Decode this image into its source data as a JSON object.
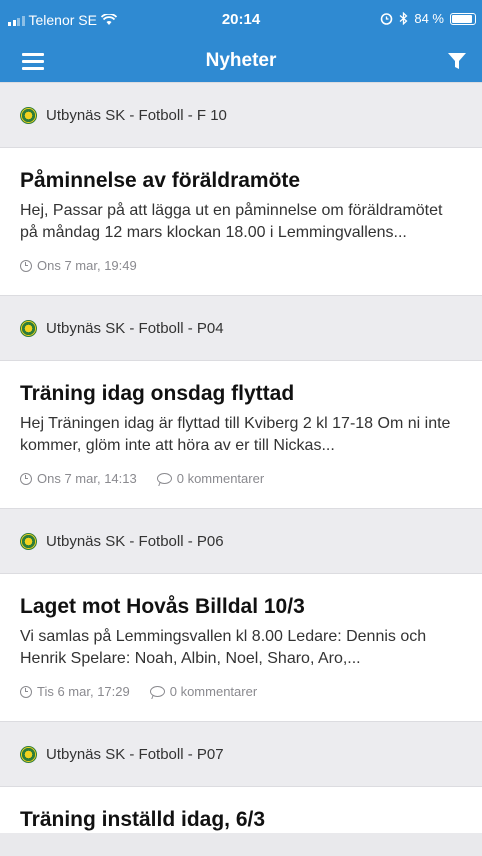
{
  "status_bar": {
    "carrier": "Telenor SE",
    "time": "20:14",
    "battery": "84 %",
    "icons": [
      "signal-icon",
      "wifi-icon",
      "alarm-icon",
      "bluetooth-icon",
      "battery-icon"
    ]
  },
  "navbar": {
    "title": "Nyheter",
    "menu_icon": "hamburger-icon",
    "filter_icon": "filter-icon"
  },
  "colors": {
    "accent": "#2f8ad2",
    "background": "#ececef"
  },
  "feed": [
    {
      "club": "Utbynäs SK - Fotboll - F 10",
      "title": "Påminnelse av föräldramöte",
      "excerpt": "Hej,   Passar på att lägga ut en påminnelse om föräldramötet på måndag 12 mars klockan 18.00 i Lemmingvallens...",
      "date": "Ons 7 mar, 19:49",
      "comments": ""
    },
    {
      "club": "Utbynäs SK - Fotboll - P04",
      "title": "Träning idag onsdag flyttad",
      "excerpt": "Hej Träningen idag är flyttad till Kviberg 2 kl 17-18   Om ni inte kommer, glöm inte att höra av er till Nickas...",
      "date": "Ons 7 mar, 14:13",
      "comments": "0 kommentarer"
    },
    {
      "club": "Utbynäs SK - Fotboll - P06",
      "title": "Laget mot Hovås Billdal 10/3",
      "excerpt": "Vi samlas på Lemmingsvallen kl 8.00    Ledare: Dennis och Henrik   Spelare: Noah, Albin, Noel, Sharo, Aro,...",
      "date": "Tis 6 mar, 17:29",
      "comments": "0 kommentarer"
    },
    {
      "club": "Utbynäs SK - Fotboll - P07",
      "title": "Träning inställd idag, 6/3",
      "excerpt": "",
      "date": "",
      "comments": ""
    }
  ]
}
